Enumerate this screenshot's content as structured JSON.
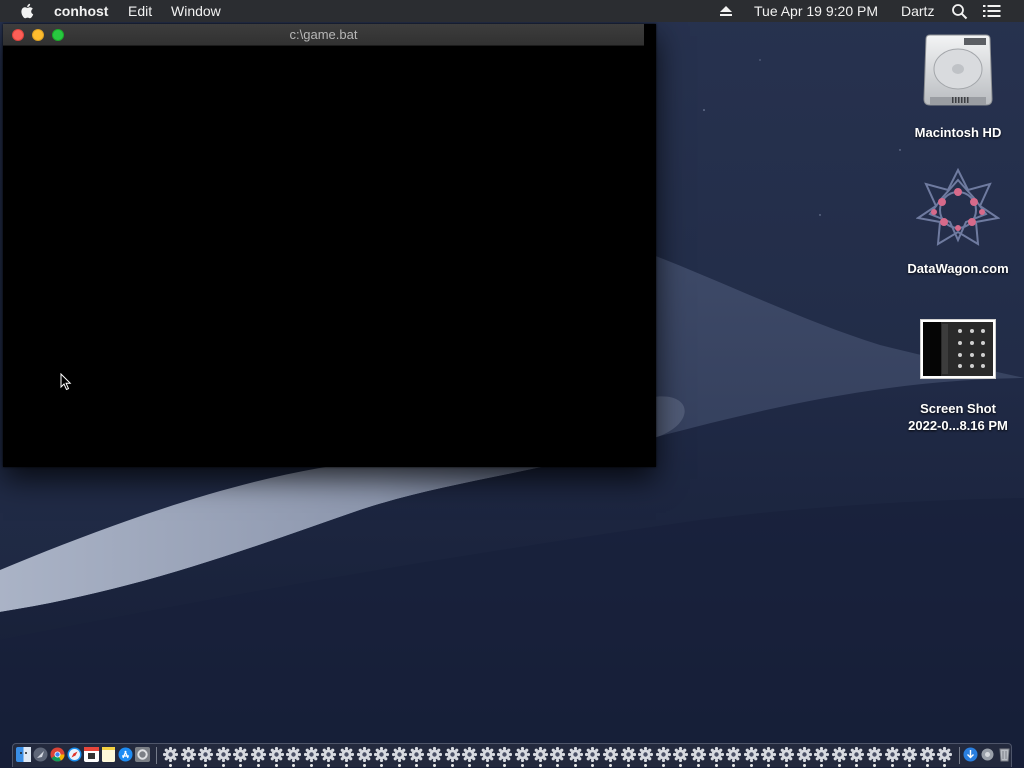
{
  "menubar": {
    "apple_icon": "apple-icon",
    "app_name": "conhost",
    "menus": [
      "Edit",
      "Window"
    ],
    "eject_icon": "eject-icon",
    "clock": "Tue Apr 19  9:20 PM",
    "user": "Dartz",
    "search_icon": "spotlight-search-icon",
    "notification_icon": "notification-center-icon"
  },
  "terminal": {
    "title": "c:\\game.bat",
    "close_icon": "close-icon",
    "minimize_icon": "minimize-icon",
    "zoom_icon": "zoom-icon"
  },
  "desktop": {
    "icons": [
      {
        "label": "Macintosh HD",
        "icon": "hard-drive-icon"
      },
      {
        "label": "DataWagon.com",
        "icon": "datawagon-logo-icon"
      },
      {
        "label": "Screen Shot\n2022-0...8.16 PM",
        "icon": "screenshot-thumbnail-icon"
      }
    ]
  },
  "dock": {
    "apps": [
      "finder-icon",
      "launchpad-icon",
      "chrome-icon",
      "safari-icon",
      "calendar-icon",
      "notes-icon",
      "app-store-icon",
      "system-preferences-icon"
    ],
    "running_windows_count": 45,
    "right_items": [
      "downloads-icon",
      "applications-icon",
      "trash-icon"
    ]
  },
  "colors": {
    "menubar_bg": "#2b2d31",
    "terminal_bg": "#000000",
    "traffic_close": "#fe5f57",
    "traffic_minimize": "#febc2e",
    "traffic_zoom": "#28c840"
  }
}
